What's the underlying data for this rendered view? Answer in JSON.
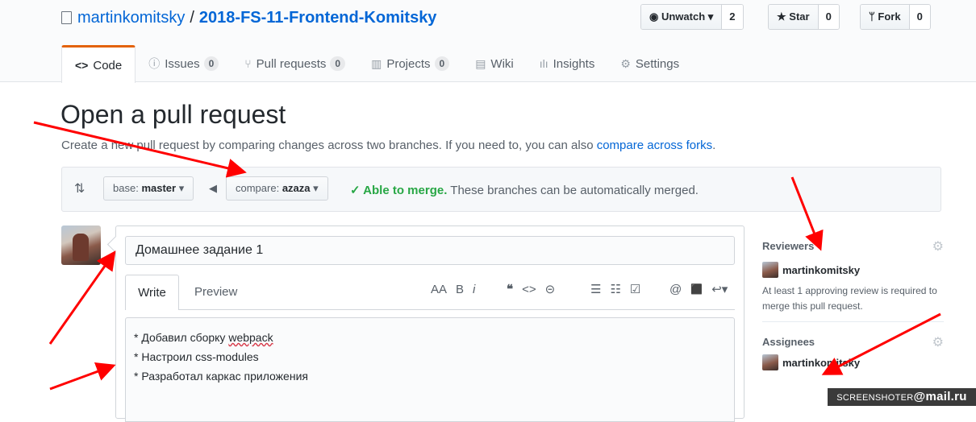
{
  "repo": {
    "owner": "martinkomitsky",
    "separator": "/",
    "name": "2018-FS-11-Frontend-Komitsky"
  },
  "actions": {
    "watch": {
      "label": "Unwatch ▾",
      "count": "2"
    },
    "star": {
      "label": "Star",
      "count": "0"
    },
    "fork": {
      "label": "Fork",
      "count": "0"
    }
  },
  "tabs": [
    {
      "label": "Code",
      "icon": "code-icon"
    },
    {
      "label": "Issues",
      "icon": "issue-icon",
      "count": "0"
    },
    {
      "label": "Pull requests",
      "icon": "pull-request-icon",
      "count": "0"
    },
    {
      "label": "Projects",
      "icon": "project-icon",
      "count": "0"
    },
    {
      "label": "Wiki",
      "icon": "book-icon"
    },
    {
      "label": "Insights",
      "icon": "graph-icon"
    },
    {
      "label": "Settings",
      "icon": "gear-icon"
    }
  ],
  "page": {
    "title": "Open a pull request",
    "subtitle_text": "Create a new pull request by comparing changes across two branches. If you need to, you can also ",
    "subtitle_link": "compare across forks",
    "subtitle_end": "."
  },
  "compare": {
    "base_prefix": "base:",
    "base_branch": "master",
    "compare_prefix": "compare:",
    "compare_branch": "azaza",
    "status_ok": "✓ Able to merge.",
    "status_text": "These branches can be automatically merged."
  },
  "form": {
    "title_value": "Домашнее задание 1",
    "tab_write": "Write",
    "tab_preview": "Preview",
    "body_lines": [
      {
        "prefix": "* Добавил сборку ",
        "underlined": "webpack"
      },
      {
        "prefix": "* Настроил css-modules",
        "underlined": ""
      },
      {
        "prefix": "* Разработал каркас приложения",
        "underlined": ""
      }
    ]
  },
  "toolbar": {
    "header": "AA",
    "bold": "B",
    "italic": "i",
    "quote": "❝",
    "code": "<>",
    "link": "⊝",
    "ul": "☰",
    "ol": "☷",
    "task": "☑",
    "mention": "@",
    "reference": "⬛",
    "reply": "↩▾"
  },
  "sidebar": {
    "reviewers_heading": "Reviewers",
    "reviewer": "martinkomitsky",
    "note": "At least 1 approving review is required to merge this pull request.",
    "assignees_heading": "Assignees",
    "assignee": "martinkomitsky"
  },
  "watermark": {
    "left": "SCREENSHOTER",
    "right": "@mail.ru"
  },
  "colors": {
    "link": "#0366d6",
    "success": "#28a745",
    "tab_accent": "#e36209",
    "annotation_arrow": "#ff0000"
  }
}
